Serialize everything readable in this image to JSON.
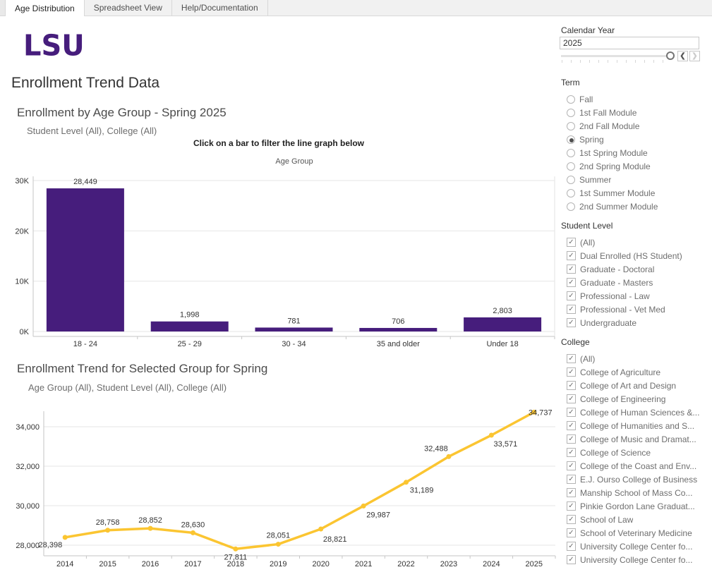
{
  "tabs": [
    {
      "label": "Age Distribution",
      "active": true
    },
    {
      "label": "Spreadsheet View",
      "active": false
    },
    {
      "label": "Help/Documentation",
      "active": false
    }
  ],
  "logo_text": "LSU",
  "page_title": "Enrollment Trend Data",
  "bar_section": {
    "title": "Enrollment by Age Group - Spring 2025",
    "subtitle": "Student Level (All), College (All)",
    "caption": "Click on a bar to filter the line graph below",
    "column_header": "Age Group"
  },
  "line_section": {
    "title": "Enrollment Trend for Selected Group for Spring",
    "subtitle": "Age Group (All), Student Level (All), College (All)"
  },
  "filters": {
    "calendar_year": {
      "label": "Calendar Year",
      "value": "2025"
    },
    "term": {
      "label": "Term",
      "selected": "Spring",
      "options": [
        "Fall",
        "1st Fall Module",
        "2nd Fall Module",
        "Spring",
        "1st Spring Module",
        "2nd Spring Module",
        "Summer",
        "1st Summer Module",
        "2nd Summer Module"
      ]
    },
    "student_level": {
      "label": "Student Level",
      "all_checked": true,
      "options": [
        "(All)",
        "Dual Enrolled (HS Student)",
        "Graduate - Doctoral",
        "Graduate - Masters",
        "Professional - Law",
        "Professional - Vet Med",
        "Undergraduate"
      ]
    },
    "college": {
      "label": "College",
      "all_checked": true,
      "options": [
        "(All)",
        "College of Agriculture",
        "College of Art and Design",
        "College of Engineering",
        "College of Human Sciences &...",
        "College of Humanities and S...",
        "College of Music and Dramat...",
        "College of Science",
        "College of the Coast and Env...",
        "E.J. Ourso College of Business",
        "Manship School of Mass Co...",
        "Pinkie Gordon Lane Graduat...",
        "School of Law",
        "School of Veterinary Medicine",
        "University College Center fo...",
        "University College Center fo..."
      ]
    }
  },
  "colors": {
    "lsu_purple": "#461D7C",
    "lsu_gold": "#FBC531",
    "grid": "#e6e6e6",
    "axis": "#c6c6c6",
    "tick_text": "#333333"
  },
  "chart_data": [
    {
      "type": "bar",
      "title": "Enrollment by Age Group - Spring 2025",
      "axis_title": "Age Group",
      "categories": [
        "18 - 24",
        "25 - 29",
        "30 - 34",
        "35 and older",
        "Under 18"
      ],
      "values": [
        28449,
        1998,
        781,
        706,
        2803
      ],
      "data_labels": [
        "28,449",
        "1,998",
        "781",
        "706",
        "2,803"
      ],
      "ytick_values": [
        0,
        10000,
        20000,
        30000
      ],
      "ytick_labels": [
        "0K",
        "10K",
        "20K",
        "30K"
      ],
      "ylim": [
        0,
        32500
      ],
      "grid": true,
      "bar_color": "#461D7C"
    },
    {
      "type": "line",
      "title": "Enrollment Trend for Selected Group for Spring",
      "x": [
        2014,
        2015,
        2016,
        2017,
        2018,
        2019,
        2020,
        2021,
        2022,
        2023,
        2024,
        2025
      ],
      "values": [
        28398,
        28758,
        28852,
        28630,
        27811,
        28051,
        28821,
        29987,
        31189,
        32488,
        33571,
        34737
      ],
      "data_labels": [
        "28,398",
        "28,758",
        "28,852",
        "28,630",
        "27,811",
        "28,051",
        "28,821",
        "29,987",
        "31,189",
        "32,488",
        "33,571",
        "34,737"
      ],
      "ytick_values": [
        28000,
        30000,
        32000,
        34000
      ],
      "ytick_labels": [
        "28,000",
        "30,000",
        "32,000",
        "34,000"
      ],
      "ylim": [
        27500,
        35300
      ],
      "grid": true,
      "line_color": "#FBC531"
    }
  ]
}
